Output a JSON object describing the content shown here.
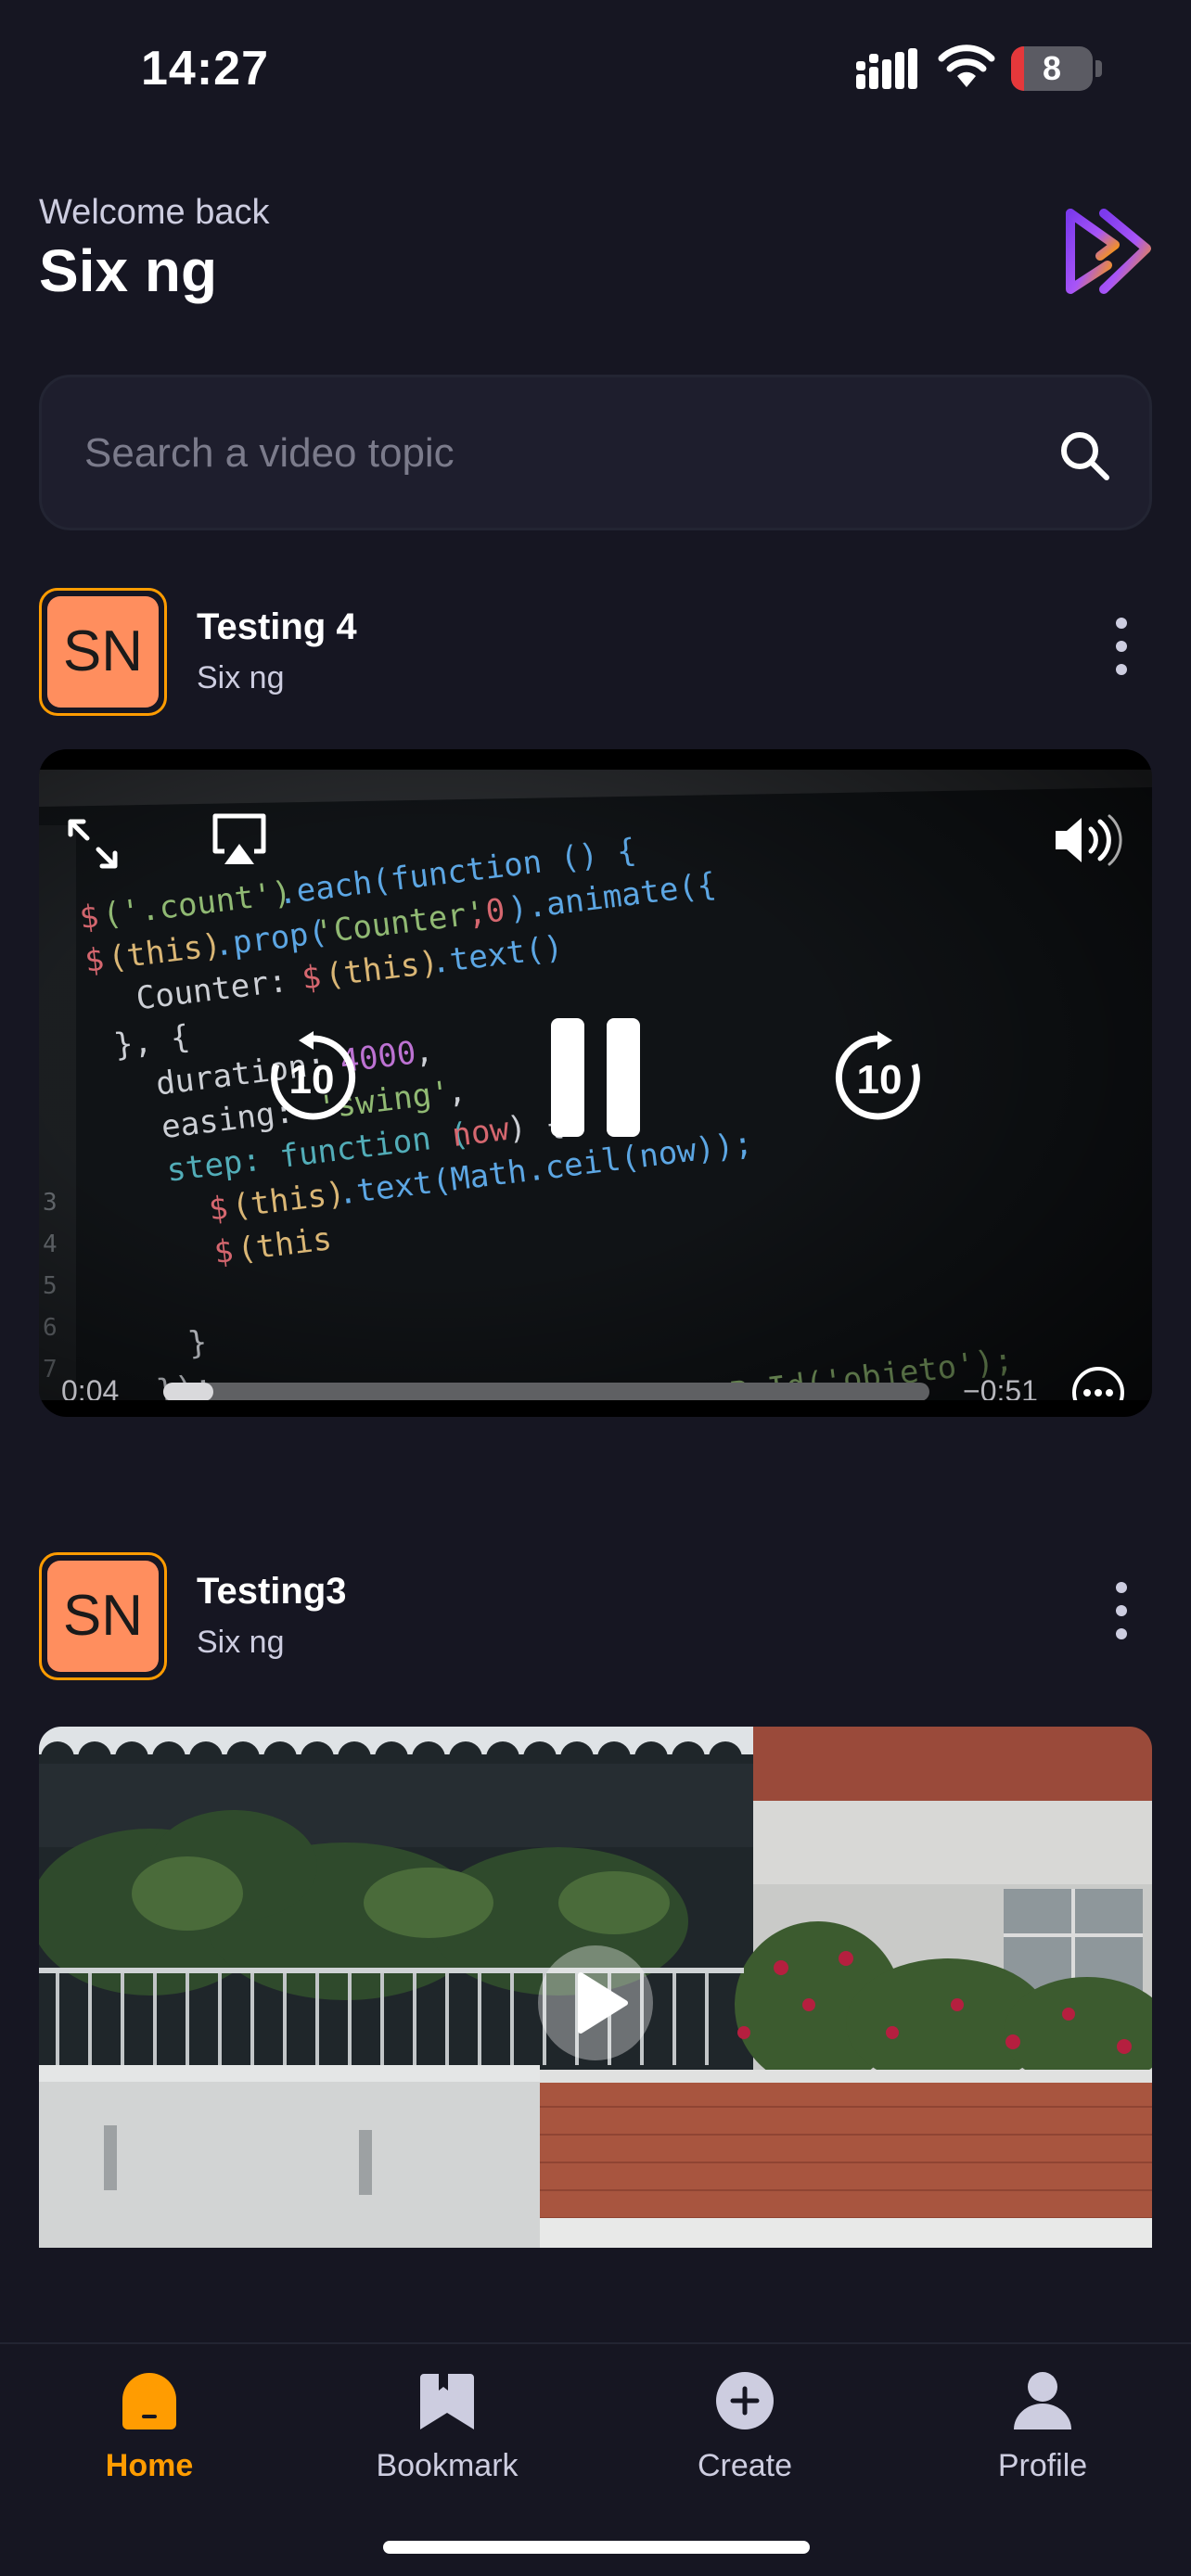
{
  "status_bar": {
    "time": "14:27",
    "battery": "8",
    "battery_level": 0.08
  },
  "header": {
    "welcome": "Welcome back",
    "username": "Six ng",
    "logo_icon": "app-logo-icon"
  },
  "search": {
    "placeholder": "Search a video topic",
    "value": ""
  },
  "posts": [
    {
      "title": "Testing 4",
      "author": "Six ng",
      "avatar_initials": "SN",
      "player": {
        "state": "playing",
        "elapsed": "0:04",
        "remaining": "−0:51",
        "progress": 0.065,
        "skip_back_seconds": "10",
        "skip_forward_seconds": "10"
      }
    },
    {
      "title": "Testing3",
      "author": "Six ng",
      "avatar_initials": "SN",
      "player": {
        "state": "paused"
      }
    }
  ],
  "nav": {
    "items": [
      {
        "label": "Home",
        "icon": "home-icon",
        "active": true
      },
      {
        "label": "Bookmark",
        "icon": "bookmark-icon",
        "active": false
      },
      {
        "label": "Create",
        "icon": "plus-circle-icon",
        "active": false
      },
      {
        "label": "Profile",
        "icon": "profile-icon",
        "active": false
      }
    ]
  },
  "colors": {
    "background": "#161622",
    "accent": "#ff9c01",
    "avatar_fill": "#ff8e5e",
    "logo_gradient_start": "#7c3aed",
    "logo_gradient_end": "#ff9c01",
    "text_muted": "#cdcde0"
  }
}
